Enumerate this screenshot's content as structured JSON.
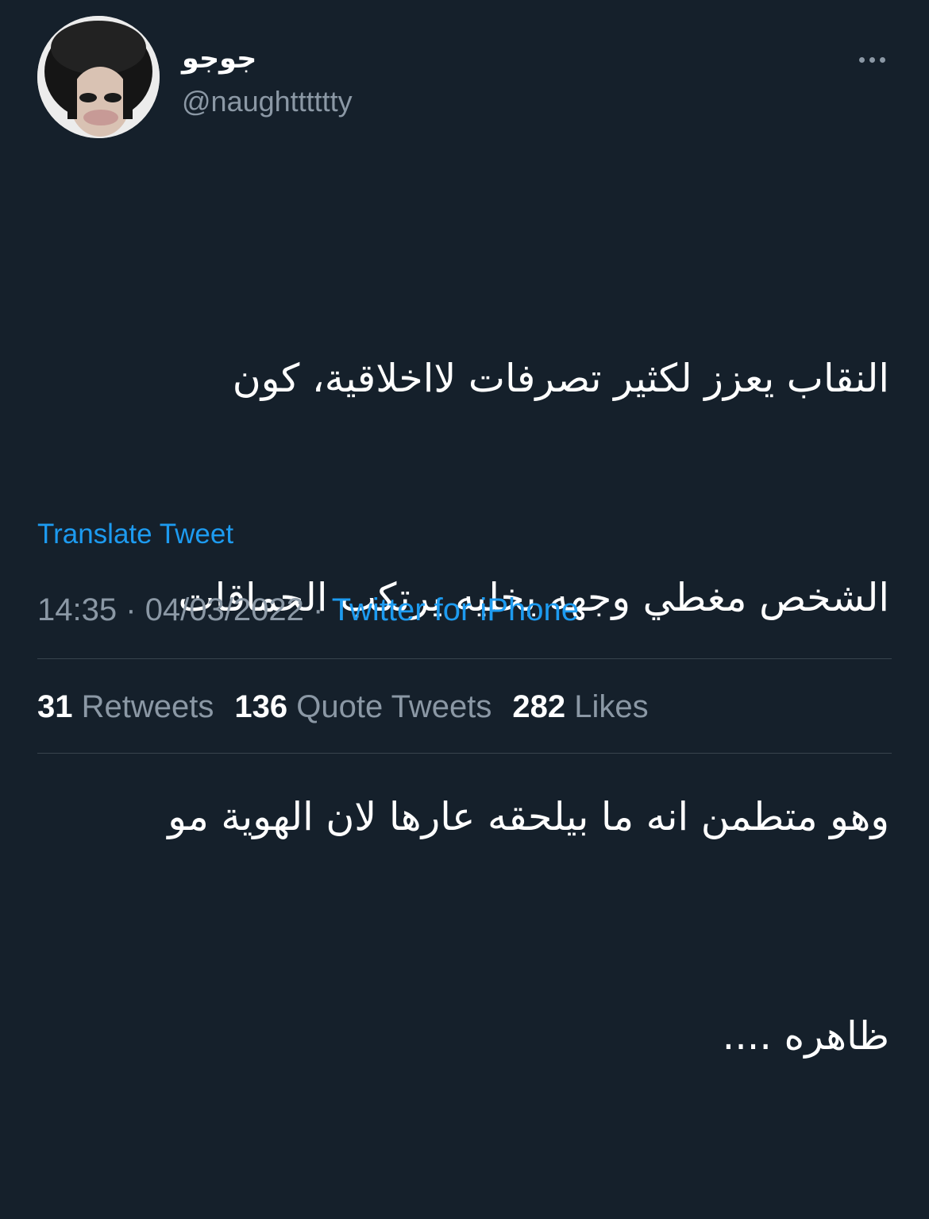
{
  "author": {
    "display_name": "جوجو",
    "handle": "@naughtttttty",
    "avatar_icon": "profile-photo"
  },
  "tweet": {
    "lines": [
      "النقاب يعزز لكثير تصرفات لااخلاقية، كون",
      "الشخص مغطي وجهه يخليه يرتكب الحماقات",
      "وهو متطمن انه ما بيلحقه عارها لان الهوية مو",
      "ظاهره ...."
    ],
    "translate_label": "Translate Tweet",
    "time": "14:35",
    "separator": "·",
    "date": "04/03/2022",
    "source": "Twitter for iPhone"
  },
  "stats": {
    "retweets": {
      "count": "31",
      "label": "Retweets"
    },
    "quote_tweets": {
      "count": "136",
      "label": "Quote Tweets"
    },
    "likes": {
      "count": "282",
      "label": "Likes"
    }
  },
  "colors": {
    "background": "#15202b",
    "text_primary": "#ffffff",
    "text_secondary": "#8b98a5",
    "accent": "#1d9bf0",
    "divider": "#38444d"
  },
  "more_icon": "more-horizontal-icon"
}
